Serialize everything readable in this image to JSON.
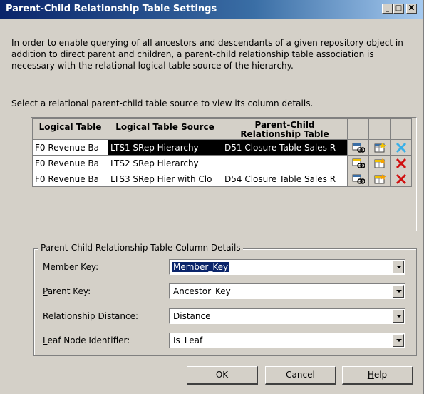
{
  "window": {
    "title": "Parent-Child Relationship Table Settings",
    "minimize_label": "_",
    "maximize_label": "□",
    "close_label": "X"
  },
  "intro_text": "In order to enable querying of all ancestors and descendants of a given repository object in addition to direct parent and children, a parent-child relationship table association is necessary with the relational logical table source of the hierarchy.",
  "select_label": "Select a relational parent-child table source to view its column details.",
  "table": {
    "columns": [
      "Logical Table",
      "Logical Table Source",
      "Parent-Child Relationship Table"
    ],
    "rows": [
      {
        "logical_table": "F0 Revenue Ba",
        "source": "LTS1 SRep Hierarchy",
        "pc_table": "D51 Closure Table Sales R",
        "selected": true
      },
      {
        "logical_table": "F0 Revenue Ba",
        "source": "LTS2 SRep Hierarchy",
        "pc_table": "",
        "selected": false
      },
      {
        "logical_table": "F0 Revenue Ba",
        "source": "LTS3 SRep Hier with Clo",
        "pc_table": "D54 Closure Table Sales R",
        "selected": false
      }
    ],
    "row_icons": [
      "select-table-icon",
      "new-table-icon",
      "delete-icon"
    ]
  },
  "details": {
    "legend": "Parent-Child Relationship Table Column Details",
    "fields": [
      {
        "label": "Member Key:",
        "value": "Member_Key"
      },
      {
        "label": "Parent Key:",
        "value": "Ancestor_Key"
      },
      {
        "label": "Relationship Distance:",
        "value": "Distance"
      },
      {
        "label": "Leaf Node Identifier:",
        "value": "Is_Leaf"
      }
    ]
  },
  "buttons": {
    "ok": "OK",
    "cancel": "Cancel",
    "help": "Help"
  },
  "colors": {
    "title_bar": "#0a246a",
    "dialog_bg": "#d4d0c8",
    "selection": "#000000",
    "delete_red": "#d01010"
  }
}
